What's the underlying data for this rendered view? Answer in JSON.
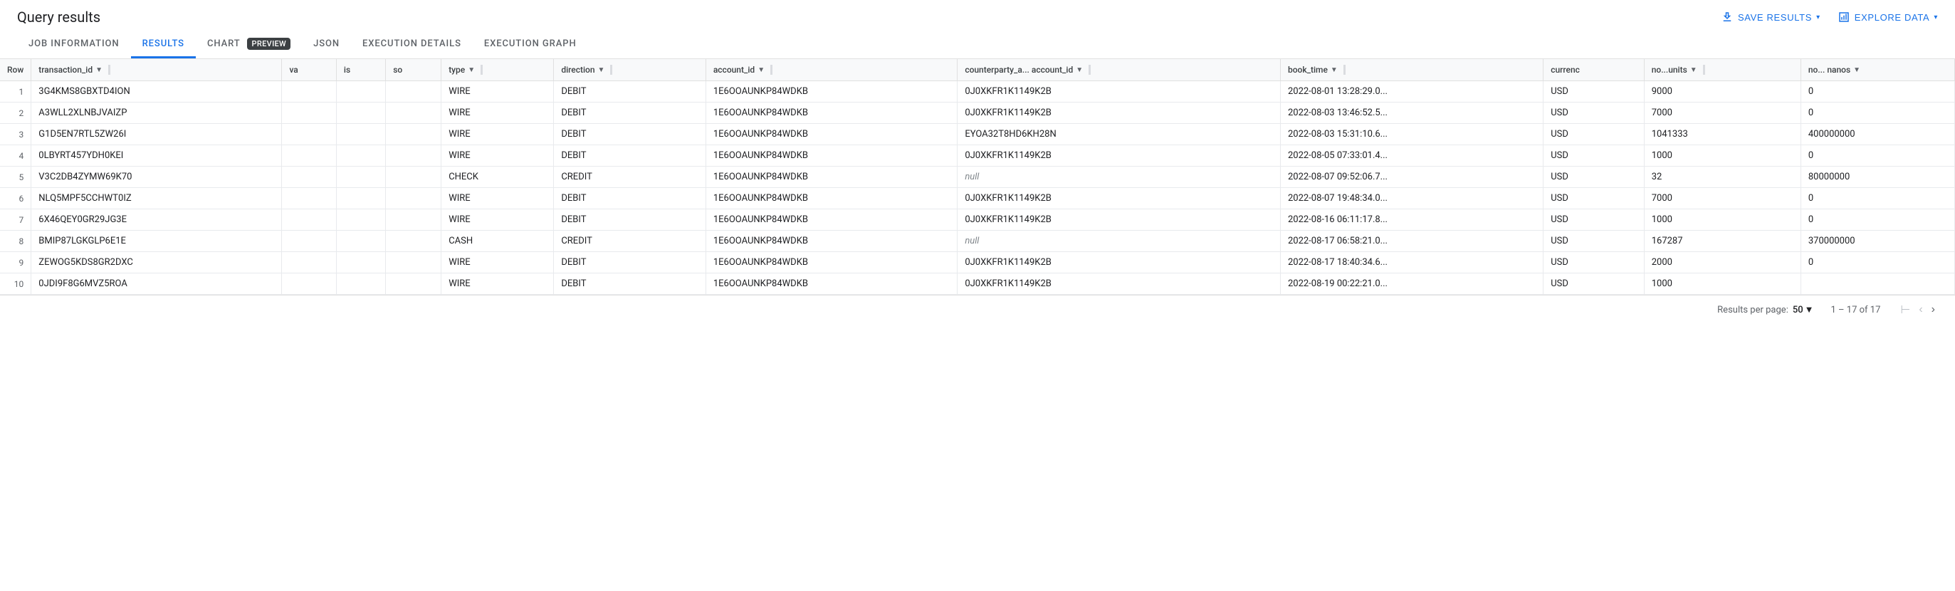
{
  "header": {
    "title": "Query results",
    "save_results_label": "SAVE RESULTS",
    "explore_data_label": "EXPLORE DATA"
  },
  "tabs": [
    {
      "id": "job-information",
      "label": "JOB INFORMATION",
      "active": false
    },
    {
      "id": "results",
      "label": "RESULTS",
      "active": true
    },
    {
      "id": "chart",
      "label": "CHART",
      "active": false,
      "badge": "PREVIEW"
    },
    {
      "id": "json",
      "label": "JSON",
      "active": false
    },
    {
      "id": "execution-details",
      "label": "EXECUTION DETAILS",
      "active": false
    },
    {
      "id": "execution-graph",
      "label": "EXECUTION GRAPH",
      "active": false
    }
  ],
  "table": {
    "columns": [
      {
        "id": "row",
        "label": "Row",
        "sortable": false
      },
      {
        "id": "transaction_id",
        "label": "transaction_id",
        "sortable": true
      },
      {
        "id": "va",
        "label": "va",
        "sortable": false
      },
      {
        "id": "is",
        "label": "is",
        "sortable": false
      },
      {
        "id": "so",
        "label": "so",
        "sortable": false
      },
      {
        "id": "type",
        "label": "type",
        "sortable": true
      },
      {
        "id": "direction",
        "label": "direction",
        "sortable": true
      },
      {
        "id": "account_id",
        "label": "account_id",
        "sortable": true
      },
      {
        "id": "counterparty_a_account_id",
        "label": "counterparty_a... account_id",
        "sortable": true
      },
      {
        "id": "book_time",
        "label": "book_time",
        "sortable": true
      },
      {
        "id": "currency",
        "label": "currenc",
        "sortable": false
      },
      {
        "id": "no_units",
        "label": "no...units",
        "sortable": true
      },
      {
        "id": "no_nanos",
        "label": "no... nanos",
        "sortable": true
      }
    ],
    "rows": [
      {
        "row": "1",
        "transaction_id": "3G4KMS8GBXTD4ION",
        "va": "",
        "is": "",
        "so": "",
        "type": "WIRE",
        "direction": "DEBIT",
        "account_id": "1E6OOAUNKP84WDKB",
        "counterparty_a_account_id": "0J0XKFR1K1149K2B",
        "book_time": "2022-08-01 13:28:29.0...",
        "currency": "USD",
        "no_units": "9000",
        "no_nanos": "0"
      },
      {
        "row": "2",
        "transaction_id": "A3WLL2XLNBJVAIZP",
        "va": "",
        "is": "",
        "so": "",
        "type": "WIRE",
        "direction": "DEBIT",
        "account_id": "1E6OOAUNKP84WDKB",
        "counterparty_a_account_id": "0J0XKFR1K1149K2B",
        "book_time": "2022-08-03 13:46:52.5...",
        "currency": "USD",
        "no_units": "7000",
        "no_nanos": "0"
      },
      {
        "row": "3",
        "transaction_id": "G1D5EN7RTL5ZW26I",
        "va": "",
        "is": "",
        "so": "",
        "type": "WIRE",
        "direction": "DEBIT",
        "account_id": "1E6OOAUNKP84WDKB",
        "counterparty_a_account_id": "EYOA32T8HD6KH28N",
        "book_time": "2022-08-03 15:31:10.6...",
        "currency": "USD",
        "no_units": "1041333",
        "no_nanos": "400000000"
      },
      {
        "row": "4",
        "transaction_id": "0LBYRT457YDH0KEI",
        "va": "",
        "is": "",
        "so": "",
        "type": "WIRE",
        "direction": "DEBIT",
        "account_id": "1E6OOAUNKP84WDKB",
        "counterparty_a_account_id": "0J0XKFR1K1149K2B",
        "book_time": "2022-08-05 07:33:01.4...",
        "currency": "USD",
        "no_units": "1000",
        "no_nanos": "0"
      },
      {
        "row": "5",
        "transaction_id": "V3C2DB4ZYMW69K70",
        "va": "",
        "is": "",
        "so": "",
        "type": "CHECK",
        "direction": "CREDIT",
        "account_id": "1E6OOAUNKP84WDKB",
        "counterparty_a_account_id": null,
        "book_time": "2022-08-07 09:52:06.7...",
        "currency": "USD",
        "no_units": "32",
        "no_nanos": "80000000"
      },
      {
        "row": "6",
        "transaction_id": "NLQ5MPF5CCHWT0IZ",
        "va": "",
        "is": "",
        "so": "",
        "type": "WIRE",
        "direction": "DEBIT",
        "account_id": "1E6OOAUNKP84WDKB",
        "counterparty_a_account_id": "0J0XKFR1K1149K2B",
        "book_time": "2022-08-07 19:48:34.0...",
        "currency": "USD",
        "no_units": "7000",
        "no_nanos": "0"
      },
      {
        "row": "7",
        "transaction_id": "6X46QEY0GR29JG3E",
        "va": "",
        "is": "",
        "so": "",
        "type": "WIRE",
        "direction": "DEBIT",
        "account_id": "1E6OOAUNKP84WDKB",
        "counterparty_a_account_id": "0J0XKFR1K1149K2B",
        "book_time": "2022-08-16 06:11:17.8...",
        "currency": "USD",
        "no_units": "1000",
        "no_nanos": "0"
      },
      {
        "row": "8",
        "transaction_id": "BMIP87LGKGLP6E1E",
        "va": "",
        "is": "",
        "so": "",
        "type": "CASH",
        "direction": "CREDIT",
        "account_id": "1E6OOAUNKP84WDKB",
        "counterparty_a_account_id": null,
        "book_time": "2022-08-17 06:58:21.0...",
        "currency": "USD",
        "no_units": "167287",
        "no_nanos": "370000000"
      },
      {
        "row": "9",
        "transaction_id": "ZEWOG5KDS8GR2DXC",
        "va": "",
        "is": "",
        "so": "",
        "type": "WIRE",
        "direction": "DEBIT",
        "account_id": "1E6OOAUNKP84WDKB",
        "counterparty_a_account_id": "0J0XKFR1K1149K2B",
        "book_time": "2022-08-17 18:40:34.6...",
        "currency": "USD",
        "no_units": "2000",
        "no_nanos": "0"
      },
      {
        "row": "10",
        "transaction_id": "0JDI9F8G6MVZ5ROA",
        "va": "",
        "is": "",
        "so": "",
        "type": "WIRE",
        "direction": "DEBIT",
        "account_id": "1E6OOAUNKP84WDKB",
        "counterparty_a_account_id": "0J0XKFR1K1149K2B",
        "book_time": "2022-08-19 00:22:21.0...",
        "currency": "USD",
        "no_units": "1000",
        "no_nanos": ""
      }
    ]
  },
  "footer": {
    "results_per_page_label": "Results per page:",
    "per_page_value": "50",
    "range_label": "1 – 17 of 17"
  }
}
